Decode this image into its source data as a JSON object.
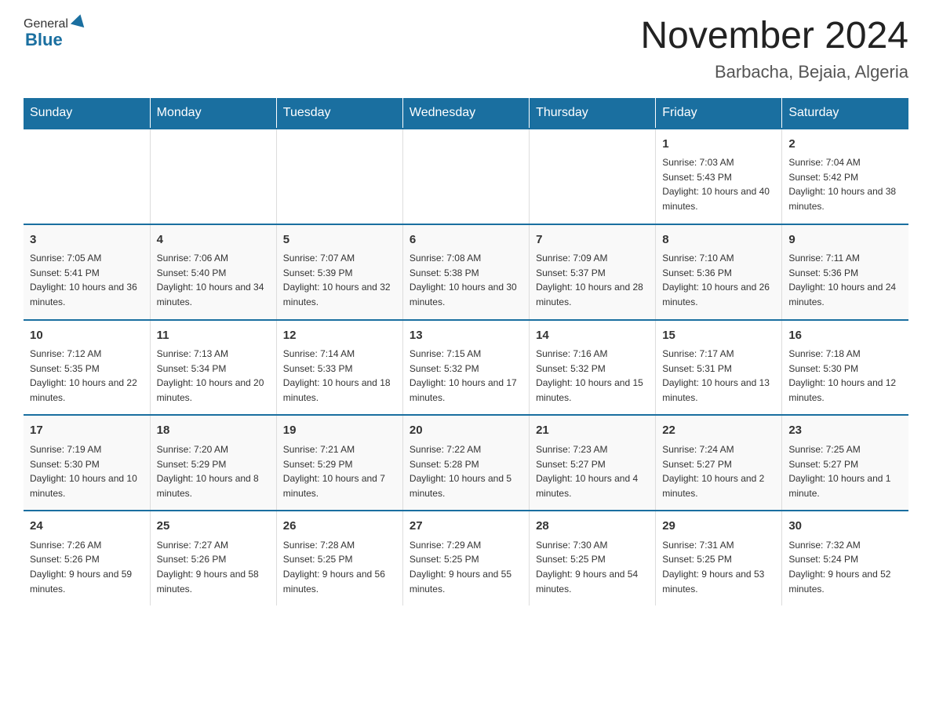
{
  "header": {
    "logo_general": "General",
    "logo_blue": "Blue",
    "title": "November 2024",
    "subtitle": "Barbacha, Bejaia, Algeria"
  },
  "days_of_week": [
    "Sunday",
    "Monday",
    "Tuesday",
    "Wednesday",
    "Thursday",
    "Friday",
    "Saturday"
  ],
  "weeks": [
    [
      {
        "day": "",
        "sunrise": "",
        "sunset": "",
        "daylight": ""
      },
      {
        "day": "",
        "sunrise": "",
        "sunset": "",
        "daylight": ""
      },
      {
        "day": "",
        "sunrise": "",
        "sunset": "",
        "daylight": ""
      },
      {
        "day": "",
        "sunrise": "",
        "sunset": "",
        "daylight": ""
      },
      {
        "day": "",
        "sunrise": "",
        "sunset": "",
        "daylight": ""
      },
      {
        "day": "1",
        "sunrise": "Sunrise: 7:03 AM",
        "sunset": "Sunset: 5:43 PM",
        "daylight": "Daylight: 10 hours and 40 minutes."
      },
      {
        "day": "2",
        "sunrise": "Sunrise: 7:04 AM",
        "sunset": "Sunset: 5:42 PM",
        "daylight": "Daylight: 10 hours and 38 minutes."
      }
    ],
    [
      {
        "day": "3",
        "sunrise": "Sunrise: 7:05 AM",
        "sunset": "Sunset: 5:41 PM",
        "daylight": "Daylight: 10 hours and 36 minutes."
      },
      {
        "day": "4",
        "sunrise": "Sunrise: 7:06 AM",
        "sunset": "Sunset: 5:40 PM",
        "daylight": "Daylight: 10 hours and 34 minutes."
      },
      {
        "day": "5",
        "sunrise": "Sunrise: 7:07 AM",
        "sunset": "Sunset: 5:39 PM",
        "daylight": "Daylight: 10 hours and 32 minutes."
      },
      {
        "day": "6",
        "sunrise": "Sunrise: 7:08 AM",
        "sunset": "Sunset: 5:38 PM",
        "daylight": "Daylight: 10 hours and 30 minutes."
      },
      {
        "day": "7",
        "sunrise": "Sunrise: 7:09 AM",
        "sunset": "Sunset: 5:37 PM",
        "daylight": "Daylight: 10 hours and 28 minutes."
      },
      {
        "day": "8",
        "sunrise": "Sunrise: 7:10 AM",
        "sunset": "Sunset: 5:36 PM",
        "daylight": "Daylight: 10 hours and 26 minutes."
      },
      {
        "day": "9",
        "sunrise": "Sunrise: 7:11 AM",
        "sunset": "Sunset: 5:36 PM",
        "daylight": "Daylight: 10 hours and 24 minutes."
      }
    ],
    [
      {
        "day": "10",
        "sunrise": "Sunrise: 7:12 AM",
        "sunset": "Sunset: 5:35 PM",
        "daylight": "Daylight: 10 hours and 22 minutes."
      },
      {
        "day": "11",
        "sunrise": "Sunrise: 7:13 AM",
        "sunset": "Sunset: 5:34 PM",
        "daylight": "Daylight: 10 hours and 20 minutes."
      },
      {
        "day": "12",
        "sunrise": "Sunrise: 7:14 AM",
        "sunset": "Sunset: 5:33 PM",
        "daylight": "Daylight: 10 hours and 18 minutes."
      },
      {
        "day": "13",
        "sunrise": "Sunrise: 7:15 AM",
        "sunset": "Sunset: 5:32 PM",
        "daylight": "Daylight: 10 hours and 17 minutes."
      },
      {
        "day": "14",
        "sunrise": "Sunrise: 7:16 AM",
        "sunset": "Sunset: 5:32 PM",
        "daylight": "Daylight: 10 hours and 15 minutes."
      },
      {
        "day": "15",
        "sunrise": "Sunrise: 7:17 AM",
        "sunset": "Sunset: 5:31 PM",
        "daylight": "Daylight: 10 hours and 13 minutes."
      },
      {
        "day": "16",
        "sunrise": "Sunrise: 7:18 AM",
        "sunset": "Sunset: 5:30 PM",
        "daylight": "Daylight: 10 hours and 12 minutes."
      }
    ],
    [
      {
        "day": "17",
        "sunrise": "Sunrise: 7:19 AM",
        "sunset": "Sunset: 5:30 PM",
        "daylight": "Daylight: 10 hours and 10 minutes."
      },
      {
        "day": "18",
        "sunrise": "Sunrise: 7:20 AM",
        "sunset": "Sunset: 5:29 PM",
        "daylight": "Daylight: 10 hours and 8 minutes."
      },
      {
        "day": "19",
        "sunrise": "Sunrise: 7:21 AM",
        "sunset": "Sunset: 5:29 PM",
        "daylight": "Daylight: 10 hours and 7 minutes."
      },
      {
        "day": "20",
        "sunrise": "Sunrise: 7:22 AM",
        "sunset": "Sunset: 5:28 PM",
        "daylight": "Daylight: 10 hours and 5 minutes."
      },
      {
        "day": "21",
        "sunrise": "Sunrise: 7:23 AM",
        "sunset": "Sunset: 5:27 PM",
        "daylight": "Daylight: 10 hours and 4 minutes."
      },
      {
        "day": "22",
        "sunrise": "Sunrise: 7:24 AM",
        "sunset": "Sunset: 5:27 PM",
        "daylight": "Daylight: 10 hours and 2 minutes."
      },
      {
        "day": "23",
        "sunrise": "Sunrise: 7:25 AM",
        "sunset": "Sunset: 5:27 PM",
        "daylight": "Daylight: 10 hours and 1 minute."
      }
    ],
    [
      {
        "day": "24",
        "sunrise": "Sunrise: 7:26 AM",
        "sunset": "Sunset: 5:26 PM",
        "daylight": "Daylight: 9 hours and 59 minutes."
      },
      {
        "day": "25",
        "sunrise": "Sunrise: 7:27 AM",
        "sunset": "Sunset: 5:26 PM",
        "daylight": "Daylight: 9 hours and 58 minutes."
      },
      {
        "day": "26",
        "sunrise": "Sunrise: 7:28 AM",
        "sunset": "Sunset: 5:25 PM",
        "daylight": "Daylight: 9 hours and 56 minutes."
      },
      {
        "day": "27",
        "sunrise": "Sunrise: 7:29 AM",
        "sunset": "Sunset: 5:25 PM",
        "daylight": "Daylight: 9 hours and 55 minutes."
      },
      {
        "day": "28",
        "sunrise": "Sunrise: 7:30 AM",
        "sunset": "Sunset: 5:25 PM",
        "daylight": "Daylight: 9 hours and 54 minutes."
      },
      {
        "day": "29",
        "sunrise": "Sunrise: 7:31 AM",
        "sunset": "Sunset: 5:25 PM",
        "daylight": "Daylight: 9 hours and 53 minutes."
      },
      {
        "day": "30",
        "sunrise": "Sunrise: 7:32 AM",
        "sunset": "Sunset: 5:24 PM",
        "daylight": "Daylight: 9 hours and 52 minutes."
      }
    ]
  ]
}
